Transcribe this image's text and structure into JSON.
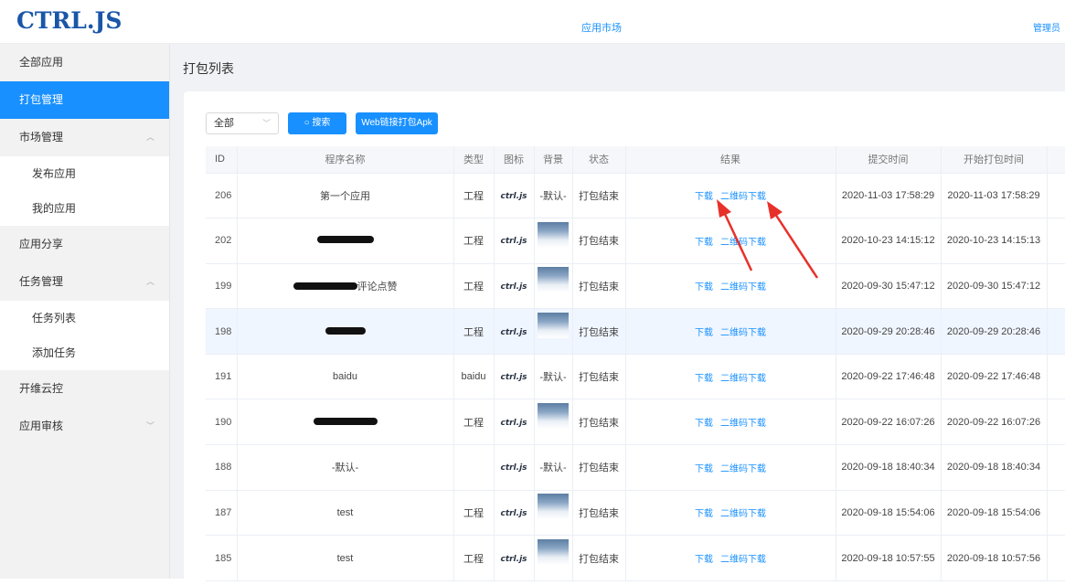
{
  "topbar": {
    "logo": "CTRL.JS",
    "market": "应用市场",
    "admin": "管理员"
  },
  "sidebar": {
    "all_apps": "全部应用",
    "pack_manage": "打包管理",
    "market_manage": "市场管理",
    "publish_app": "发布应用",
    "my_apps": "我的应用",
    "app_share": "应用分享",
    "task_manage": "任务管理",
    "task_list": "任务列表",
    "add_task": "添加任务",
    "cloud_control": "开维云控",
    "app_review": "应用审核"
  },
  "page": {
    "title": "打包列表"
  },
  "toolbar": {
    "select_value": "全部",
    "search_label": "搜索",
    "web_pack_label": "Web链接打包Apk"
  },
  "table": {
    "headers": {
      "id": "ID",
      "name": "程序名称",
      "type": "类型",
      "icon": "图标",
      "bg": "背景",
      "status": "状态",
      "result": "结果",
      "submit_time": "提交时间",
      "start_time": "开始打包时间"
    },
    "download_label": "下载",
    "qr_label": "二维码下载",
    "icon_text": "ctrl.js",
    "rows": [
      {
        "id": "206",
        "name": "第一个应用",
        "type": "工程",
        "bg": "-默认-",
        "status": "打包结束",
        "submit": "2020-11-03 17:58:29",
        "start": "2020-11-03 17:58:29"
      },
      {
        "id": "202",
        "name": "",
        "type": "工程",
        "bg": "",
        "status": "打包结束",
        "submit": "2020-10-23 14:15:12",
        "start": "2020-10-23 14:15:13"
      },
      {
        "id": "199",
        "name": "评论点赞",
        "type": "工程",
        "bg": "",
        "status": "打包结束",
        "submit": "2020-09-30 15:47:12",
        "start": "2020-09-30 15:47:12"
      },
      {
        "id": "198",
        "name": "",
        "type": "工程",
        "bg": "",
        "status": "打包结束",
        "submit": "2020-09-29 20:28:46",
        "start": "2020-09-29 20:28:46"
      },
      {
        "id": "191",
        "name": "baidu",
        "type": "baidu",
        "bg": "-默认-",
        "status": "打包结束",
        "submit": "2020-09-22 17:46:48",
        "start": "2020-09-22 17:46:48"
      },
      {
        "id": "190",
        "name": "",
        "type": "工程",
        "bg": "",
        "status": "打包结束",
        "submit": "2020-09-22 16:07:26",
        "start": "2020-09-22 16:07:26"
      },
      {
        "id": "188",
        "name": "-默认-",
        "type": "",
        "bg": "-默认-",
        "status": "打包结束",
        "submit": "2020-09-18 18:40:34",
        "start": "2020-09-18 18:40:34"
      },
      {
        "id": "187",
        "name": "test",
        "type": "工程",
        "bg": "",
        "status": "打包结束",
        "submit": "2020-09-18 15:54:06",
        "start": "2020-09-18 15:54:06"
      },
      {
        "id": "185",
        "name": "test",
        "type": "工程",
        "bg": "",
        "status": "打包结束",
        "submit": "2020-09-18 10:57:55",
        "start": "2020-09-18 10:57:56"
      }
    ]
  },
  "colors": {
    "primary": "#1890ff",
    "logo": "#1a56a8",
    "annotation_arrow": "#e8302a"
  }
}
